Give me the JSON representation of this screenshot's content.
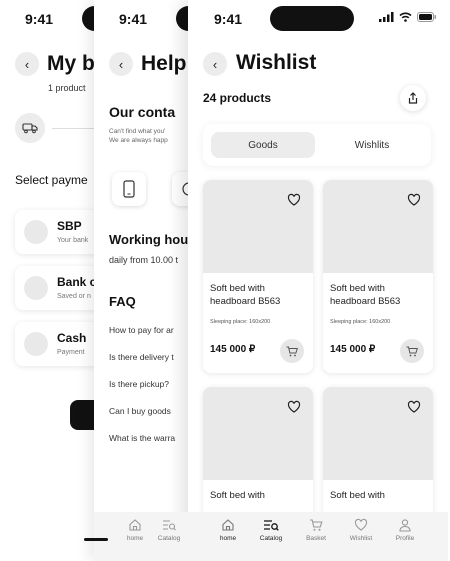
{
  "status": {
    "time": "9:41"
  },
  "screen_basket": {
    "title": "My b",
    "subtitle": "1 product",
    "section": "Select payme",
    "options": [
      {
        "title": "SBP",
        "sub": "Your bank"
      },
      {
        "title": "Bank c",
        "sub": "Saved or n"
      },
      {
        "title": "Cash",
        "sub": "Payment"
      }
    ]
  },
  "screen_help": {
    "title": "Help",
    "contacts_title": "Our conta",
    "contacts_text_1": "Can't find what you'",
    "contacts_text_2": "We are always happ",
    "working_title": "Working hou",
    "working_text": "daily from 10.00 t",
    "faq_title": "FAQ",
    "faq": [
      "How to pay for ar",
      "Is there delivery t",
      "Is there pickup?",
      "Can I buy goods",
      "What is the warra"
    ]
  },
  "screen_wishlist": {
    "title": "Wishlist",
    "count": "24 products",
    "tabs": [
      "Goods",
      "Wishlits"
    ],
    "active_tab": 0,
    "products": [
      {
        "name": "Soft bed with headboard B563",
        "spec": "Sleeping place: 160x200",
        "price": "145 000 ₽"
      },
      {
        "name": "Soft bed with headboard B563",
        "spec": "Sleeping place: 160x200",
        "price": "145 000 ₽"
      },
      {
        "name": "Soft bed with",
        "spec": "",
        "price": ""
      },
      {
        "name": "Soft bed with",
        "spec": "",
        "price": ""
      }
    ]
  },
  "nav": {
    "help_screen": [
      "home",
      "Catalog"
    ],
    "items": [
      "home",
      "Catalog",
      "Basket",
      "Wishlist",
      "Profile"
    ]
  },
  "colors": {
    "placeholder": "#e9e9e9",
    "dark": "#111111",
    "nav_bg": "#f4f4f4"
  }
}
